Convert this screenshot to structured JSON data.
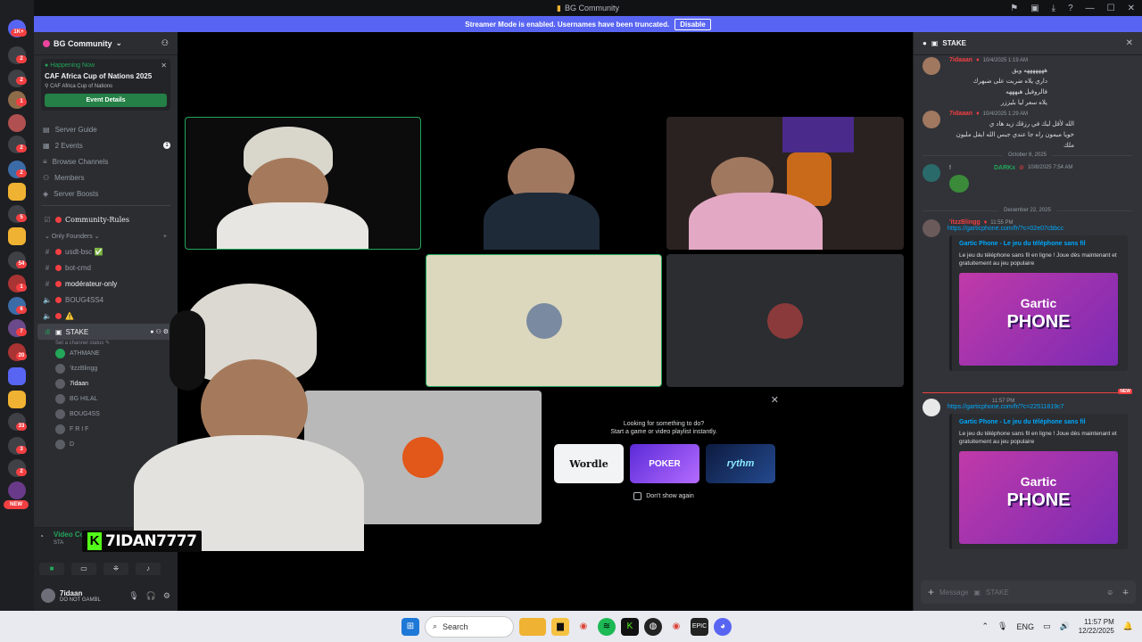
{
  "window": {
    "title": "BG Community"
  },
  "banner": {
    "text": "Streamer Mode is enabled. Usernames have been truncated.",
    "button": "Disable"
  },
  "rail": {
    "badges": [
      "1K+",
      "2",
      "2",
      "1",
      "2",
      "2",
      "5",
      "54",
      "1",
      "6",
      "7",
      "20",
      "33",
      "3",
      "2"
    ],
    "new_label": "NEW"
  },
  "server": {
    "name": "BG Community"
  },
  "event": {
    "status": "Happening Now",
    "name": "CAF Africa Cup of Nations 2025",
    "location": "CAF Africa Cup of Nations",
    "button": "Event Details"
  },
  "nav": [
    {
      "label": "Server Guide",
      "icon": "guide-icon"
    },
    {
      "label": "2 Events",
      "icon": "calendar-icon",
      "count": "1"
    },
    {
      "label": "Browse Channels",
      "icon": "browse-icon"
    },
    {
      "label": "Members",
      "icon": "members-icon"
    },
    {
      "label": "Server Boosts",
      "icon": "boost-icon"
    }
  ],
  "channels": {
    "rules": "Community-Rules",
    "category": "Only Founders",
    "list": [
      "usdt-bsc ✅",
      "bot-cmd",
      "modérateur-only",
      "BOUG4SS4",
      "⚠️"
    ],
    "active": "STAKE",
    "active_status": "Set a channel status"
  },
  "voice_members": [
    "ATHMANE",
    "'itzzBlingg",
    "7idaan",
    "BG HILAL",
    "BOUG4SS",
    "F R I F",
    "D"
  ],
  "voice_panel": {
    "title": "Video Co",
    "subtitle": "STA"
  },
  "user": {
    "name": "7idaan",
    "status": "DO NOT GAMBL"
  },
  "activity": {
    "line1": "Looking for something to do?",
    "line2": "Start a game or video playlist instantly.",
    "cards": [
      "Wordle",
      "POKER",
      "rythm"
    ],
    "dont_show": "Don't show again"
  },
  "streamer_tag": {
    "k": "K",
    "name": "7IDAN7777"
  },
  "chat": {
    "channel": "STAKE",
    "messages": [
      {
        "user": "7idaaan",
        "time": "10/4/2025 1:19 AM",
        "lines": [
          "هههههههه ويق",
          "داري يلاه ضربت على ضبهرك فالروفيل هيهههه",
          "يلاه سعر ليا بليززر"
        ],
        "color": "#f23f42"
      },
      {
        "user": "7idaaan",
        "time": "10/4/2025 1:29 AM",
        "lines": [
          "الله لأقل ليك في رزقك زيد هاد ي",
          "خويا ميمون راه جا عندي جبس الله ايقل ملبون ملك"
        ],
        "color": "#f23f42"
      },
      {
        "user": "DARKx",
        "time": "10/8/2025 7:54 AM",
        "lines": [
          "!"
        ],
        "color": "#23a55a"
      },
      {
        "user": "'itzzBlingg",
        "time": "11:55 PM",
        "link": "https://garticphone.com/fr/?c=02e07cbbcc",
        "color": "#f23f42"
      },
      {
        "user": "",
        "time": "11:57 PM",
        "link": "https://garticphone.com/fr/?c=22511819c7",
        "color": "#dbdee1"
      }
    ],
    "dates": [
      "October 8, 2025",
      "December 22, 2025"
    ],
    "new_label": "NEW",
    "embed": {
      "title": "Gartic Phone - Le jeu du téléphone sans fil",
      "desc": "Le jeu du téléphone sans fil en ligne ! Joue dès maintenant et gratuitement au jeu populaire",
      "logo_top": "Gartic",
      "logo_bottom": "PHONE"
    },
    "input_placeholder": "Message",
    "input_channel": "STAKE"
  },
  "taskbar": {
    "search": "Search",
    "lang": "ENG",
    "time": "11:57 PM",
    "date": "12/22/2025"
  }
}
